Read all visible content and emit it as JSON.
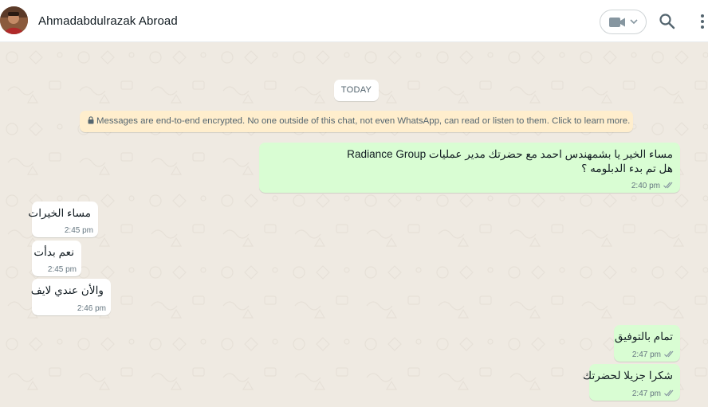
{
  "header": {
    "contact_name": "Ahmadabdulrazak Abroad",
    "video_icon": "video-camera-icon",
    "dropdown_icon": "chevron-down-icon",
    "search_icon": "search-icon",
    "menu_icon": "more-vertical-icon"
  },
  "chat": {
    "date_label": "TODAY",
    "encryption_notice": "Messages are end-to-end encrypted. No one outside of this chat, not even WhatsApp, can read or listen to them. Click to learn more.",
    "messages": [
      {
        "direction": "outgoing",
        "line1": "مساء الخير يا بشمهندس احمد مع حضرتك مدير عمليات Radiance Group",
        "line2": "هل تم بدء الدبلومه ؟",
        "time": "2:40 pm",
        "status": "read"
      },
      {
        "direction": "incoming",
        "text": "مساء الخيرات",
        "time": "2:45 pm"
      },
      {
        "direction": "incoming",
        "text": "نعم بدأت",
        "time": "2:45 pm"
      },
      {
        "direction": "incoming",
        "text": "والأن عندي لايف",
        "time": "2:46 pm"
      },
      {
        "direction": "outgoing",
        "text": "تمام بالتوفيق",
        "time": "2:47 pm",
        "status": "read"
      },
      {
        "direction": "outgoing",
        "text": "شكرا جزيلا لحضرتك",
        "time": "2:47 pm",
        "status": "read"
      }
    ]
  },
  "colors": {
    "chat_background": "#efeae2",
    "outgoing_bubble": "#d9fdd3",
    "incoming_bubble": "#ffffff",
    "encryption_banner": "#ffeecd",
    "read_tick": "#8696a0"
  }
}
